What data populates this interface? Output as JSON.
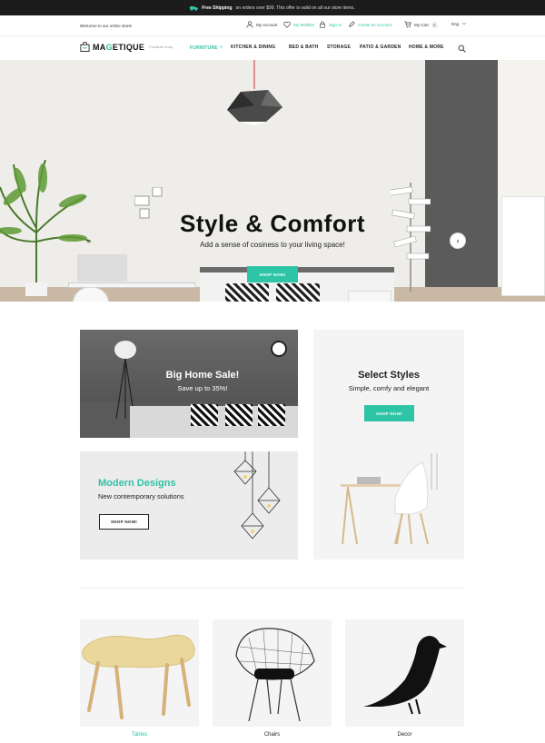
{
  "colors": {
    "accent": "#2ec4a6",
    "dark": "#1c1c1c"
  },
  "topbar": {
    "highlight": "Free Shipping",
    "message": "on orders over $99. This offer is valid on all our store items."
  },
  "utilbar": {
    "welcome": "Welcome to our online store!",
    "account": "My Account",
    "wishlist": "My Wishlist",
    "signin": "Sign In",
    "create": "Create an Account",
    "cart": "My Cart",
    "cart_count": "0",
    "language": "Eng"
  },
  "header": {
    "logo_prefix": "MA",
    "logo_highlight": "G",
    "logo_suffix": "ETIQUE",
    "tagline": "Furniture shop",
    "nav": [
      "FURNITURE",
      "KITCHEN & DINING",
      "BED & BATH",
      "STORAGE",
      "PATIO & GARDEN",
      "HOME & MORE"
    ]
  },
  "hero": {
    "title": "Style & Comfort",
    "subtitle": "Add a sense of cosiness to your living space!",
    "button": "SHOP NOW!",
    "prev": "‹",
    "next": "›"
  },
  "banners": {
    "sale": {
      "title": "Big Home Sale!",
      "subtitle": "Save up to 35%!"
    },
    "modern": {
      "title": "Modern Designs",
      "subtitle": "New contemporary solutions",
      "button": "SHOP NOW!"
    },
    "styles": {
      "title": "Select Styles",
      "subtitle": "Simple, comfy and elegant",
      "button": "SHOP NOW!"
    }
  },
  "categories": [
    {
      "label": "Tables",
      "icon": "table-icon"
    },
    {
      "label": "Chairs",
      "icon": "wire-chair-icon"
    },
    {
      "label": "Decor",
      "icon": "bird-figure-icon"
    }
  ]
}
